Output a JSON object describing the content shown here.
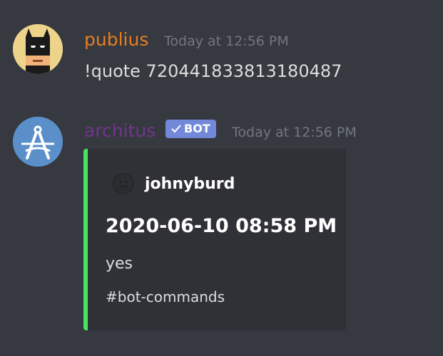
{
  "messages": [
    {
      "username": "publius",
      "username_color": "#e67e22",
      "timestamp": "Today at 12:56 PM",
      "content": "!quote 720441833813180487",
      "avatar_icon": "batman-cowl-icon"
    },
    {
      "username": "architus",
      "username_color": "#71368a",
      "bot_tag": "BOT",
      "bot_tag_icon": "checkmark-icon",
      "timestamp": "Today at 12:56 PM",
      "avatar_icon": "compass-logo-icon",
      "embed": {
        "accent_color": "#43e55e",
        "author_icon": "default-avatar-icon",
        "author": "johnyburd",
        "title": "2020-06-10 08:58 PM",
        "description": "yes",
        "footer": "#bot-commands"
      }
    }
  ]
}
